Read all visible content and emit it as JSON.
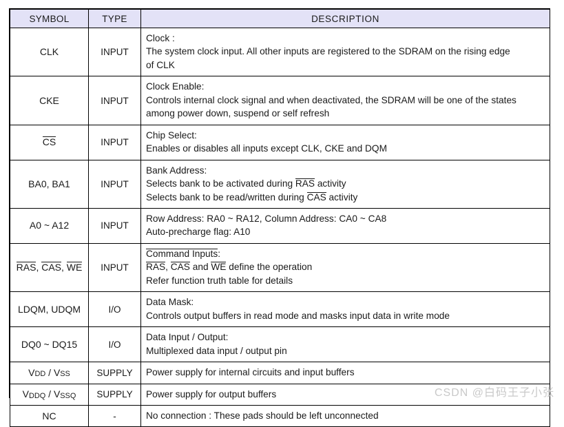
{
  "table": {
    "headers": {
      "symbol": "SYMBOL",
      "type": "TYPE",
      "description": "DESCRIPTION"
    },
    "header_bg": "#E3E2F7",
    "border_color": "#000000",
    "rows": [
      {
        "symbol": "CLK",
        "symbol_overline": "",
        "type": "INPUT",
        "desc_lines": [
          "Clock :",
          "The system clock input. All other inputs are registered to the SDRAM on the rising edge",
          "of CLK"
        ]
      },
      {
        "symbol": "CKE",
        "symbol_overline": "",
        "type": "INPUT",
        "desc_lines": [
          "Clock Enable:",
          "Controls internal clock signal and when deactivated, the SDRAM will be one of the states",
          "among power down, suspend or self refresh"
        ]
      },
      {
        "symbol": "CS",
        "symbol_overline": "CS",
        "type": "INPUT",
        "desc_lines": [
          "Chip Select:",
          "Enables or disables all inputs except CLK, CKE and DQM"
        ]
      },
      {
        "symbol": "BA0, BA1",
        "symbol_overline": "",
        "type": "INPUT",
        "desc_lines": [
          "Bank Address:",
          "Selects bank to be activated during RAS activity",
          "Selects bank to be read/written during CAS activity"
        ],
        "desc_overlines": [
          "RAS",
          "CAS"
        ]
      },
      {
        "symbol": "A0 ~ A12",
        "symbol_overline": "",
        "type": "INPUT",
        "desc_lines": [
          "Row Address: RA0 ~ RA12, Column Address: CA0 ~ CA8",
          "Auto-precharge flag: A10"
        ]
      },
      {
        "symbol": "RAS, CAS, WE",
        "symbol_overline": "RAS, CAS, WE",
        "type": "INPUT",
        "desc_lines": [
          "Command Inputs:",
          "RAS, CAS and WE define the operation",
          "Refer function truth table for details"
        ],
        "desc_overlines": [
          "RAS",
          "CAS",
          "WE",
          "Command Inputs"
        ]
      },
      {
        "symbol": "LDQM, UDQM",
        "symbol_overline": "",
        "type": "I/O",
        "desc_lines": [
          "Data Mask:",
          "Controls output buffers in read mode and masks input data in write mode"
        ]
      },
      {
        "symbol": "DQ0 ~ DQ15",
        "symbol_overline": "",
        "type": "I/O",
        "desc_lines": [
          "Data Input / Output:",
          "Multiplexed data input / output pin"
        ]
      },
      {
        "symbol": "VDD / VSS",
        "symbol_parts": [
          {
            "base": "V",
            "sub": "DD"
          },
          {
            "sep": " / "
          },
          {
            "base": "V",
            "sub": "SS"
          }
        ],
        "type": "SUPPLY",
        "desc_lines": [
          "Power supply for internal circuits and input buffers"
        ]
      },
      {
        "symbol": "VDDQ / VSSQ",
        "symbol_parts": [
          {
            "base": "V",
            "sub": "DDQ"
          },
          {
            "sep": " / "
          },
          {
            "base": "V",
            "sub": "SSQ"
          }
        ],
        "type": "SUPPLY",
        "desc_lines": [
          "Power supply for output buffers"
        ]
      },
      {
        "symbol": "NC",
        "symbol_overline": "",
        "type": "-",
        "desc_lines": [
          "No connection : These pads should be left unconnected"
        ]
      }
    ]
  },
  "watermark": {
    "text": "CSDN @白码王子小张",
    "color": "#C9C9C9"
  }
}
